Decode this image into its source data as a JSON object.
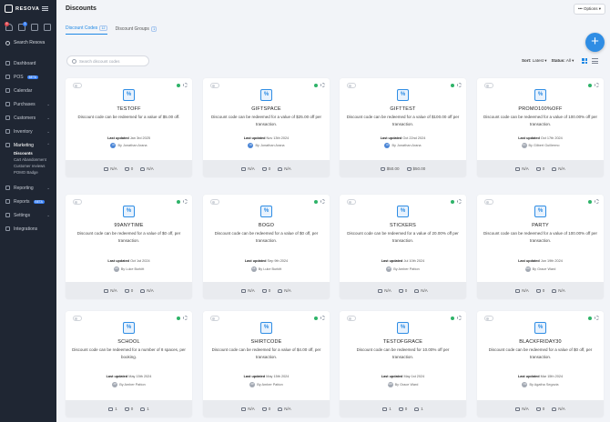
{
  "brand": {
    "name": "RESOVA"
  },
  "header": {
    "title": "Discounts",
    "options_label": "Options"
  },
  "quick_icons": {
    "notifications_badge": "9",
    "second_badge": "1"
  },
  "sidebar": {
    "search_label": "Search Resova",
    "items": [
      {
        "label": "Dashboard",
        "icon": "dashboard-icon"
      },
      {
        "label": "POS",
        "icon": "pos-icon",
        "badge": "BETA"
      },
      {
        "label": "Calendar",
        "icon": "calendar-icon"
      },
      {
        "label": "Purchases",
        "icon": "purchases-icon"
      },
      {
        "label": "Customers",
        "icon": "customers-icon"
      },
      {
        "label": "Inventory",
        "icon": "inventory-icon"
      },
      {
        "label": "Marketing",
        "icon": "marketing-icon"
      },
      {
        "label": "Reporting",
        "icon": "reporting-icon"
      },
      {
        "label": "Reports",
        "icon": "reports-icon",
        "badge": "BETA"
      },
      {
        "label": "Settings",
        "icon": "settings-icon"
      },
      {
        "label": "Integrations",
        "icon": "integrations-icon"
      }
    ],
    "marketing_sub": [
      "Discounts",
      "Cart Abandonment",
      "Customer reviews",
      "POMO Badge"
    ]
  },
  "tabs": [
    {
      "label": "Discount Codes",
      "count": "12"
    },
    {
      "label": "Discount Groups",
      "count": "1"
    }
  ],
  "search": {
    "placeholder": "Search discount codes"
  },
  "sort": {
    "label": "Sort:",
    "value": "Latest"
  },
  "status_filter": {
    "label": "Status:",
    "value": "All"
  },
  "cards": [
    {
      "code": "TESTOFF",
      "desc": "Discount code can be redeemed for a value of $5.00 off.",
      "updated_label": "Last updated",
      "updated": "Jan 3rd 2025",
      "by": "By Jonathan Arana",
      "avatar": "JA",
      "stats": [
        "N/A",
        "0",
        "N/A"
      ]
    },
    {
      "code": "GIFTSPACE",
      "desc": "Discount code can be redeemed for a value of $25.00 off per transaction.",
      "updated_label": "Last updated",
      "updated": "Nov 13th 2024",
      "by": "By Jonathan Arana",
      "avatar": "JA",
      "stats": [
        "N/A",
        "0",
        "N/A"
      ]
    },
    {
      "code": "GIFTTEST",
      "desc": "Discount code can be redeemed for a value of $100.00 off per transaction.",
      "updated_label": "Last updated",
      "updated": "Oct 22nd 2024",
      "by": "By Jonathan Arana",
      "avatar": "JA",
      "stats": [
        "$50.00",
        "$50.00"
      ]
    },
    {
      "code": "PROMO100%OFF",
      "desc": "Discount code can be redeemed for a value of 100.00% off per transaction.",
      "updated_label": "Last updated",
      "updated": "Oct 17th 2024",
      "by": "By Gilbert Guillermo",
      "avatar": "GG",
      "stats": [
        "N/A",
        "0",
        "N/A"
      ]
    },
    {
      "code": "99ANYTIME",
      "desc": "Discount code can be redeemed for a value of $0 off, per transaction.",
      "updated_label": "Last updated",
      "updated": "Oct 1st 2024",
      "by": "By Luke Burkitt",
      "avatar": "LB",
      "stats": [
        "N/A",
        "0",
        "N/A"
      ]
    },
    {
      "code": "BOGO",
      "desc": "Discount code can be redeemed for a value of $0 off, per transaction.",
      "updated_label": "Last updated",
      "updated": "Sep 9th 2024",
      "by": "By Luke Burkitt",
      "avatar": "LB",
      "stats": [
        "N/A",
        "0",
        "N/A"
      ]
    },
    {
      "code": "STICKERS",
      "desc": "Discount code can be redeemed for a value of 20.00% off per transaction.",
      "updated_label": "Last updated",
      "updated": "Jul 10th 2024",
      "by": "By Amber Patton",
      "avatar": "AP",
      "stats": [
        "N/A",
        "0",
        "N/A"
      ]
    },
    {
      "code": "PARTY",
      "desc": "Discount code can be redeemed for a value of 100.00% off per transaction.",
      "updated_label": "Last updated",
      "updated": "Jun 19th 2024",
      "by": "By Grace Ward",
      "avatar": "GW",
      "stats": [
        "N/A",
        "0",
        "N/A"
      ]
    },
    {
      "code": "SCHOOL",
      "desc": "Discount code can be redeemed for a number of 8 spaces, per booking.",
      "updated_label": "Last updated",
      "updated": "May 15th 2024",
      "by": "By Amber Patton",
      "avatar": "AP",
      "stats": [
        "1",
        "0",
        "1"
      ]
    },
    {
      "code": "SHIRTCODE",
      "desc": "Discount code can be redeemed for a value of $4.00 off, per transaction.",
      "updated_label": "Last updated",
      "updated": "May 15th 2024",
      "by": "By Amber Patton",
      "avatar": "AP",
      "stats": [
        "N/A",
        "0",
        "N/A"
      ]
    },
    {
      "code": "TESTOFGRACE",
      "desc": "Discount code can be redeemed for 10.00% off per transaction.",
      "updated_label": "Last updated",
      "updated": "May 1st 2024",
      "by": "By Grace Ward",
      "avatar": "GW",
      "stats": [
        "1",
        "0",
        "1"
      ]
    },
    {
      "code": "BLACKFRIDAY30",
      "desc": "Discount code can be redeemed for a value of $0 off, per transaction.",
      "updated_label": "Last updated",
      "updated": "Mar 15th 2024",
      "by": "By Agatha Segovia",
      "avatar": "AS",
      "stats": [
        "N/A",
        "0",
        "N/A"
      ]
    }
  ],
  "colors": {
    "sidebar": "#1f2633",
    "accent": "#2f8de4",
    "active_dot": "#2eb368"
  }
}
